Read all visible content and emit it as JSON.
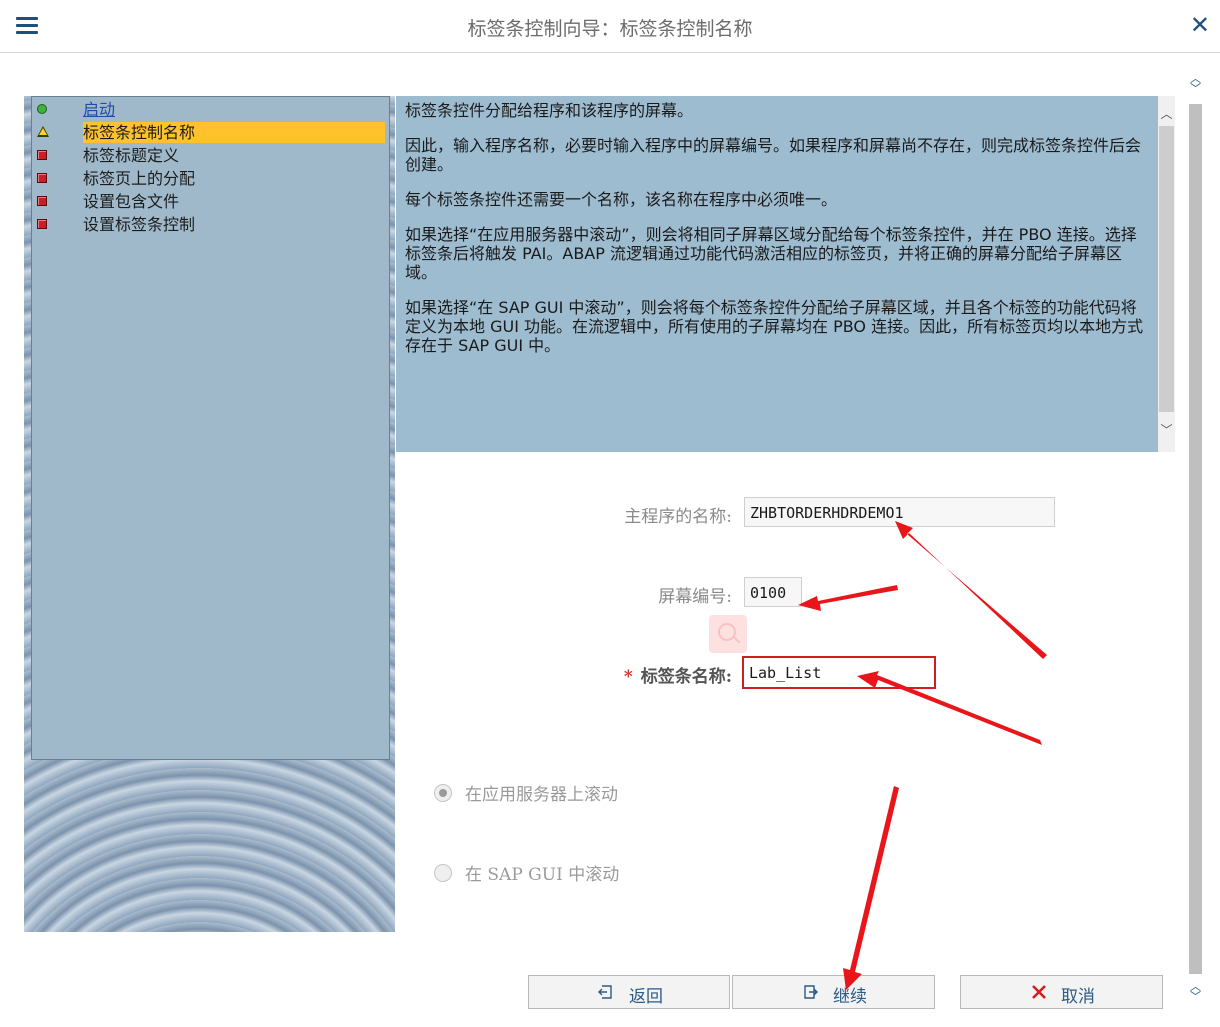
{
  "window": {
    "title": "标签条控制向导：标签条控制名称"
  },
  "steps": [
    {
      "label": "启动",
      "status": "done"
    },
    {
      "label": "标签条控制名称",
      "status": "current"
    },
    {
      "label": "标签标题定义",
      "status": "pending"
    },
    {
      "label": "标签页上的分配",
      "status": "pending"
    },
    {
      "label": "设置包含文件",
      "status": "pending"
    },
    {
      "label": "设置标签条控制",
      "status": "pending"
    }
  ],
  "info": {
    "paragraphs": [
      "标签条控件分配给程序和该程序的屏幕。",
      "因此，输入程序名称，必要时输入程序中的屏幕编号。如果程序和屏幕尚不存在，则完成标签条控件后会创建。",
      "每个标签条控件还需要一个名称，该名称在程序中必须唯一。",
      "如果选择“在应用服务器中滚动”，则会将相同子屏幕区域分配给每个标签条控件，并在 PBO 连接。选择标签条后将触发 PAI。ABAP 流逻辑通过功能代码激活相应的标签页，并将正确的屏幕分配给子屏幕区域。",
      "如果选择“在 SAP GUI 中滚动”，则会将每个标签条控件分配给子屏幕区域，并且各个标签的功能代码将定义为本地 GUI 功能。在流逻辑中，所有使用的子屏幕均在 PBO 连接。因此，所有标签页均以本地方式存在于 SAP GUI 中。"
    ]
  },
  "form": {
    "program_label": "主程序的名称:",
    "program_value": "ZHBTORDERHDRDEMO1",
    "screen_label": "屏幕编号:",
    "screen_value": "0100",
    "required_mark": "*",
    "tabstrip_label": "标签条名称:",
    "tabstrip_value": "Lab_List"
  },
  "radios": {
    "option1": "在应用服务器上滚动",
    "option2": "在 SAP GUI 中滚动",
    "selected": "option1"
  },
  "buttons": {
    "back": "返回",
    "continue": "继续",
    "cancel": "取消"
  },
  "colors": {
    "accent": "#1f4f7a",
    "current_step": "#ffc22d",
    "panel": "#9ebcd0",
    "annotation_arrow": "#e8161a"
  }
}
